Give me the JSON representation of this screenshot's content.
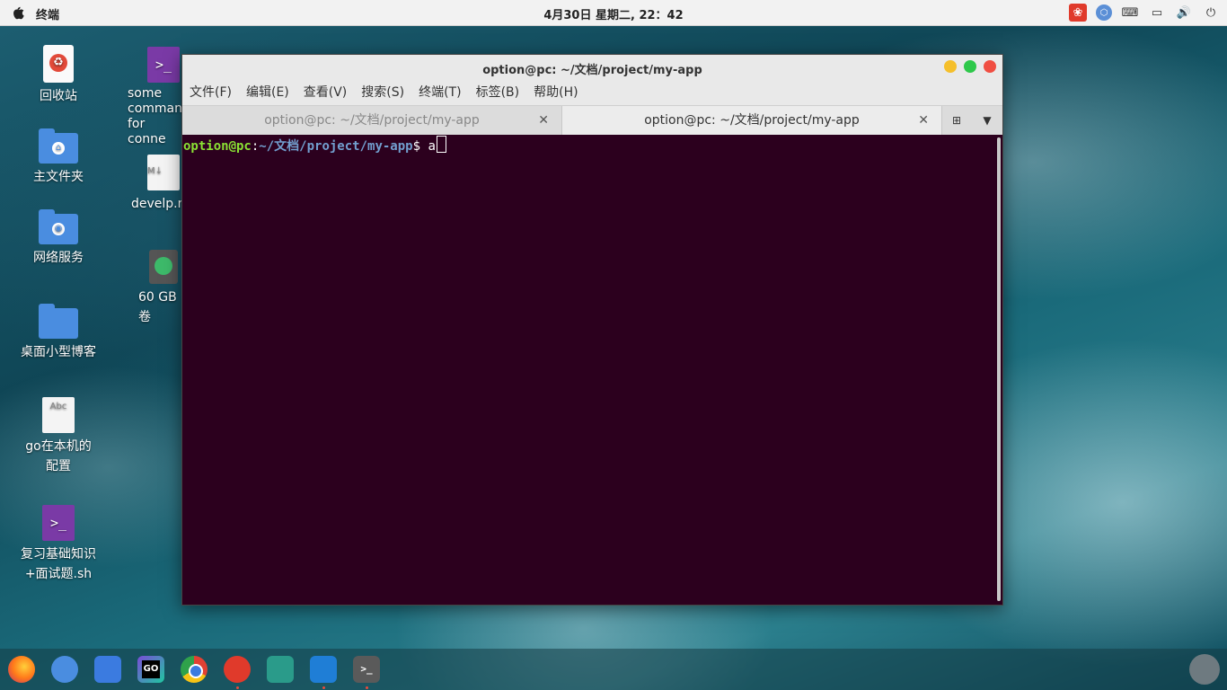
{
  "topbar": {
    "app_name": "终端",
    "clock": "4月30日 星期二, 22：42",
    "tray": {
      "netease": "❀",
      "bt": "⬡",
      "keyboard": "⌨",
      "window": "▭",
      "volume": "🔊",
      "power": "⏻"
    }
  },
  "desktop": {
    "icons": [
      {
        "label": "回收站"
      },
      {
        "label": "主文件夹"
      },
      {
        "label": "网络服务"
      },
      {
        "label": "桌面小型博客"
      },
      {
        "label": "go在本机的配置"
      },
      {
        "label": "复习基础知识+面试题.sh"
      },
      {
        "label": "some command for conne"
      },
      {
        "label": "develp.m"
      },
      {
        "label": "60 GB 卷"
      }
    ],
    "paper_text": "Abc",
    "md_text": "M↓",
    "term_glyph": ">_"
  },
  "window": {
    "title": "option@pc: ~/文档/project/my-app",
    "menu": [
      "文件(F)",
      "编辑(E)",
      "查看(V)",
      "搜索(S)",
      "终端(T)",
      "标签(B)",
      "帮助(H)"
    ],
    "tabs": [
      {
        "label": "option@pc: ~/文档/project/my-app",
        "close": "✕"
      },
      {
        "label": "option@pc: ~/文档/project/my-app",
        "close": "✕"
      }
    ],
    "new_tab": "⊞",
    "tab_menu": "▼",
    "terminal": {
      "user_host": "option@pc",
      "colon": ":",
      "path": "~/文档/project/my-app",
      "dollar": "$ ",
      "command": "a"
    }
  },
  "dock": {
    "items": [
      {
        "name": "firefox"
      },
      {
        "name": "files"
      },
      {
        "name": "store"
      },
      {
        "name": "goland",
        "text": "GO"
      },
      {
        "name": "chrome"
      },
      {
        "name": "netease-music"
      },
      {
        "name": "video"
      },
      {
        "name": "vscode"
      },
      {
        "name": "terminal",
        "text": ">_"
      },
      {
        "name": "launcher"
      }
    ]
  },
  "colors": {
    "terminal_bg": "#2c001e",
    "prompt_user": "#8ae234",
    "prompt_path": "#729fcf"
  }
}
